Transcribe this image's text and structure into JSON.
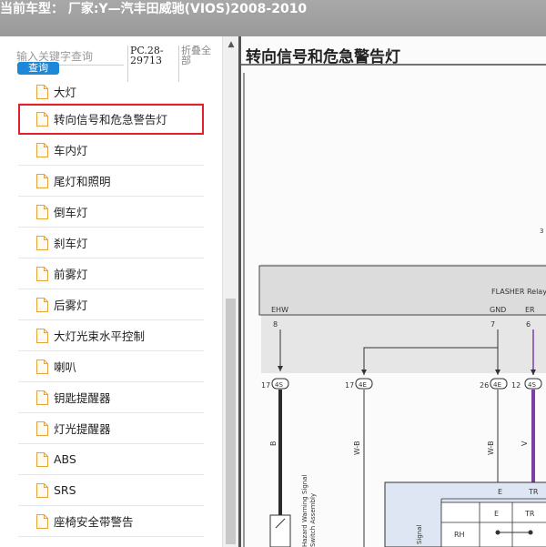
{
  "title_bar": {
    "text": "当前车型：  厂家:Y—汽丰田威驰(VIOS)2008-2010"
  },
  "search": {
    "placeholder": "输入关键字查询",
    "button_label": "查询",
    "pc_code": "PC.28-29713",
    "collapse_label": "折叠全部"
  },
  "tree": {
    "items": [
      {
        "label": "大灯",
        "selected": false
      },
      {
        "label": "转向信号和危急警告灯",
        "selected": true
      },
      {
        "label": "车内灯",
        "selected": false
      },
      {
        "label": "尾灯和照明",
        "selected": false
      },
      {
        "label": "倒车灯",
        "selected": false
      },
      {
        "label": "刹车灯",
        "selected": false
      },
      {
        "label": "前雾灯",
        "selected": false
      },
      {
        "label": "后雾灯",
        "selected": false
      },
      {
        "label": "大灯光束水平控制",
        "selected": false
      },
      {
        "label": "喇叭",
        "selected": false
      },
      {
        "label": "钥匙提醒器",
        "selected": false
      },
      {
        "label": "灯光提醒器",
        "selected": false
      },
      {
        "label": "ABS",
        "selected": false
      },
      {
        "label": "SRS",
        "selected": false
      },
      {
        "label": "座椅安全带警告",
        "selected": false
      }
    ]
  },
  "diagram": {
    "title": "转向信号和危急警告灯",
    "relay_label": "FLASHER Relay",
    "pin_ehw": "EHW",
    "pin_gnd": "GND",
    "pin_er": "ER",
    "pin_num_8": "8",
    "pin_num_7": "7",
    "pin_num_6": "6",
    "conn_17a": "17",
    "conn_4s": "4S",
    "conn_17b": "17",
    "conn_4e_a": "4E",
    "conn_26": "26",
    "conn_4e_b": "4E",
    "conn_12": "12",
    "conn_4s_b": "4S",
    "wire_b": "B",
    "wire_wb_a": "W-B",
    "wire_wb_b": "W-B",
    "wire_v": "V",
    "lower_e": "E",
    "lower_tr": "TR",
    "lower_rh": "RH",
    "switch_label_1": "Hazard Warning Signal",
    "switch_label_2": "Switch Assembly",
    "signal_label": "Signal",
    "edge_label": "3",
    "colors": {
      "relay_fill": "#dcdcdc",
      "wire_violet": "#7b3fa6",
      "wire_dark": "#2a2a2a",
      "lower_box": "#dde6f2"
    }
  }
}
